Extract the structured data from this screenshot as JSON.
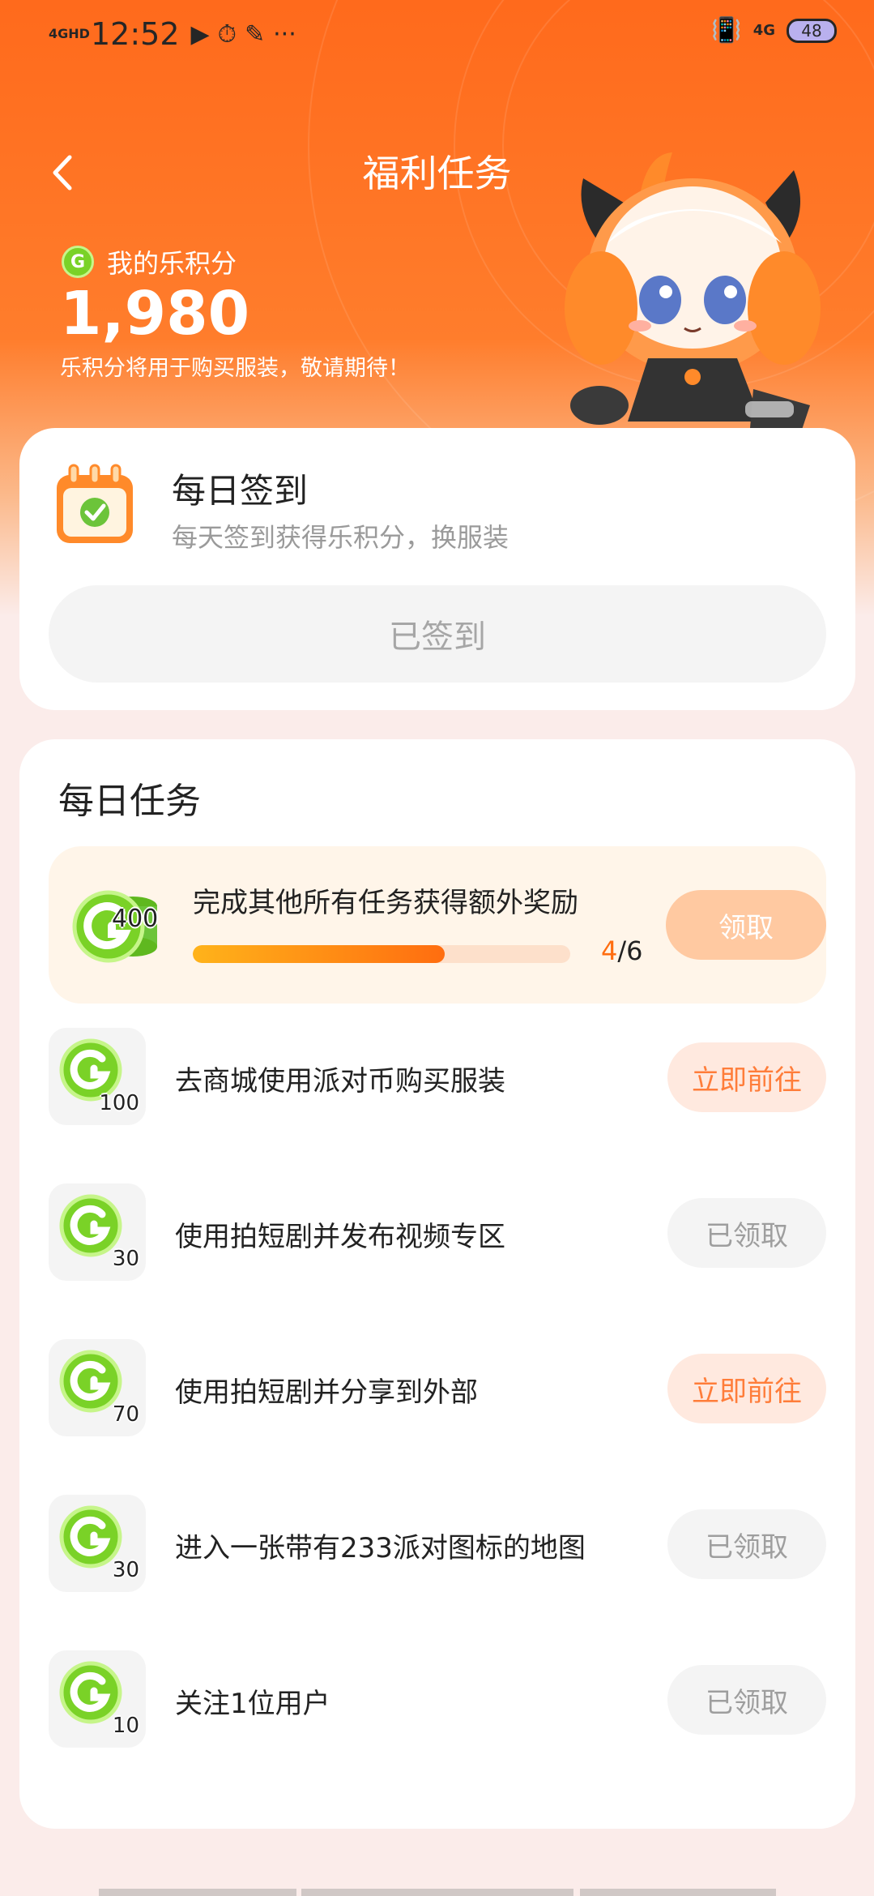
{
  "status_bar": {
    "network": "4GHD",
    "time": "12:52",
    "icons": [
      "play-icon",
      "clock-icon",
      "screenshot-icon"
    ],
    "more": "···",
    "right_network": "4G",
    "battery": "48"
  },
  "header": {
    "title": "福利任务"
  },
  "points": {
    "label": "我的乐积分",
    "value": "1,980",
    "note": "乐积分将用于购买服装，敬请期待！"
  },
  "checkin": {
    "title": "每日签到",
    "subtitle": "每天签到获得乐积分，换服装",
    "button": "已签到"
  },
  "daily_tasks": {
    "title": "每日任务",
    "bonus": {
      "reward": "400",
      "text": "完成其他所有任务获得额外奖励",
      "progress_current": "4",
      "progress_sep": "/",
      "progress_total": "6",
      "progress_fraction": 0.667,
      "button": "领取"
    },
    "tasks": [
      {
        "reward": "100",
        "label": "去商城使用派对币购买服装",
        "button": "立即前往",
        "status": "go"
      },
      {
        "reward": "30",
        "label": "使用拍短剧并发布视频专区",
        "button": "已领取",
        "status": "done"
      },
      {
        "reward": "70",
        "label": "使用拍短剧并分享到外部",
        "button": "立即前往",
        "status": "go"
      },
      {
        "reward": "30",
        "label": "进入一张带有233派对图标的地图",
        "button": "已领取",
        "status": "done"
      },
      {
        "reward": "10",
        "label": "关注1位用户",
        "button": "已领取",
        "status": "done"
      }
    ]
  },
  "colors": {
    "brand_orange": "#ff6a1c",
    "coin_green": "#7ad227",
    "go_button_bg": "#ffe9df",
    "go_button_text": "#ff7d3a"
  }
}
